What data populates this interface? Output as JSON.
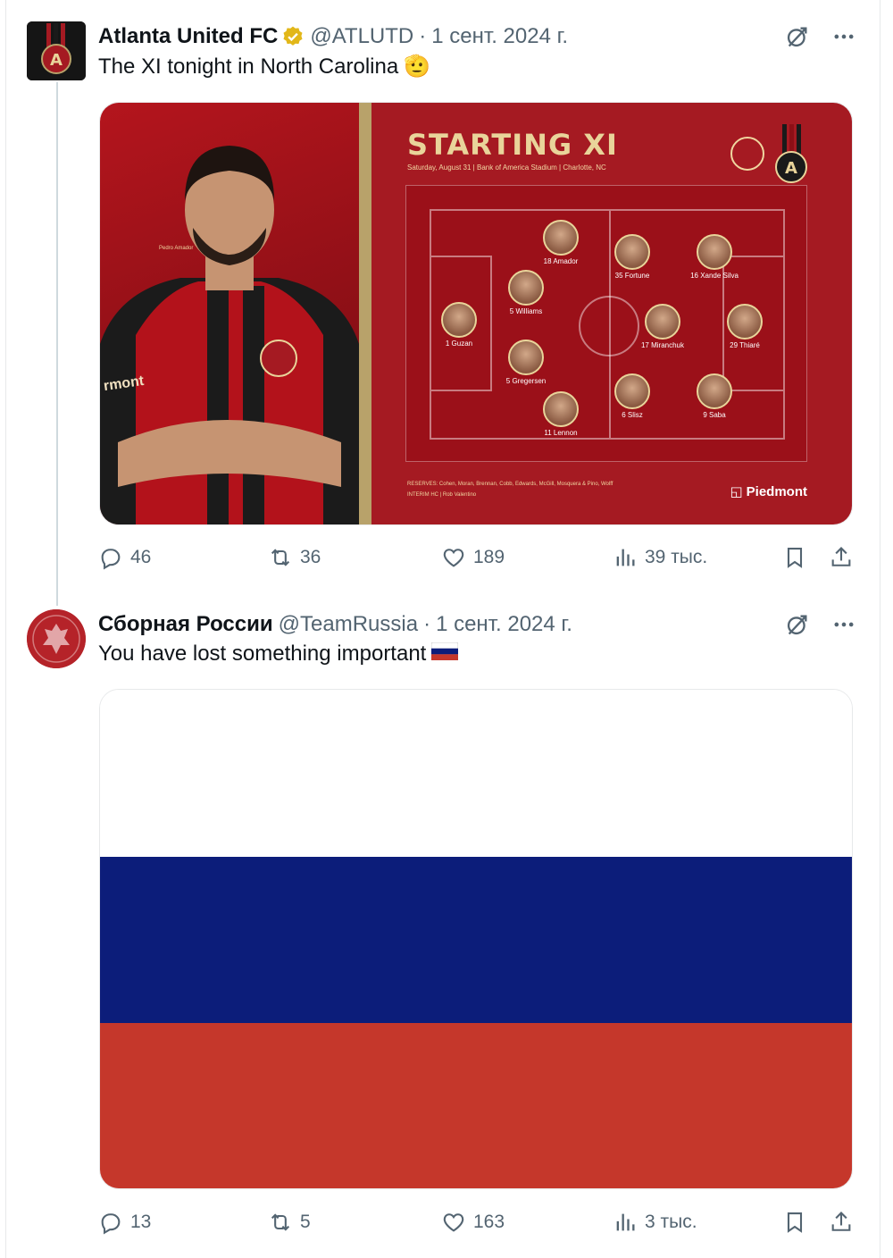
{
  "tweets": [
    {
      "author_name": "Atlanta United FC",
      "handle": "@ATLUTD",
      "separator": "·",
      "date": "1 сент. 2024 г.",
      "text": "The XI tonight in North Carolina",
      "text_emoji": "🫡",
      "image": {
        "title": "STARTING XI",
        "subtitle": "Saturday, August 31 | Bank of America Stadium | Charlotte, NC",
        "featured_player": "Pedro Amador",
        "jersey_text": "rmont",
        "lineup": [
          "1 Guzan",
          "5 Williams",
          "5 Gregersen",
          "11 Lennon",
          "18 Amador",
          "35 Fortune",
          "16 Xande Silva",
          "17 Miranchuk",
          "29 Thiaré",
          "6 Slisz",
          "9 Saba"
        ],
        "reserves_line": "RESERVES: Cohen, Moran, Brennan, Cobb, Edwards, McGill, Mosquera & Pino, Wolff",
        "interim_line": "INTERIM HC | Rob Valentino",
        "sponsor": "Piedmont"
      },
      "stats": {
        "replies": "46",
        "retweets": "36",
        "likes": "189",
        "views": "39 тыс."
      }
    },
    {
      "author_name": "Сборная России",
      "handle": "@TeamRussia",
      "separator": "·",
      "date": "1 сент. 2024 г.",
      "text": "You have lost something important",
      "text_emoji": "🇷🇺",
      "stats": {
        "replies": "13",
        "retweets": "5",
        "likes": "163",
        "views": "3 тыс."
      }
    }
  ],
  "colors": {
    "text_secondary": "#536471",
    "verified_gold": "#e2b719",
    "atlanta_red": "#a51a22",
    "atlanta_gold": "#e9d49a",
    "flag_white": "#ffffff",
    "flag_blue": "#0c1d7a",
    "flag_red": "#c5372b"
  },
  "icons": [
    "verified-badge-icon",
    "grok-icon",
    "more-icon",
    "reply-icon",
    "retweet-icon",
    "like-icon",
    "views-icon",
    "bookmark-icon",
    "share-icon"
  ]
}
